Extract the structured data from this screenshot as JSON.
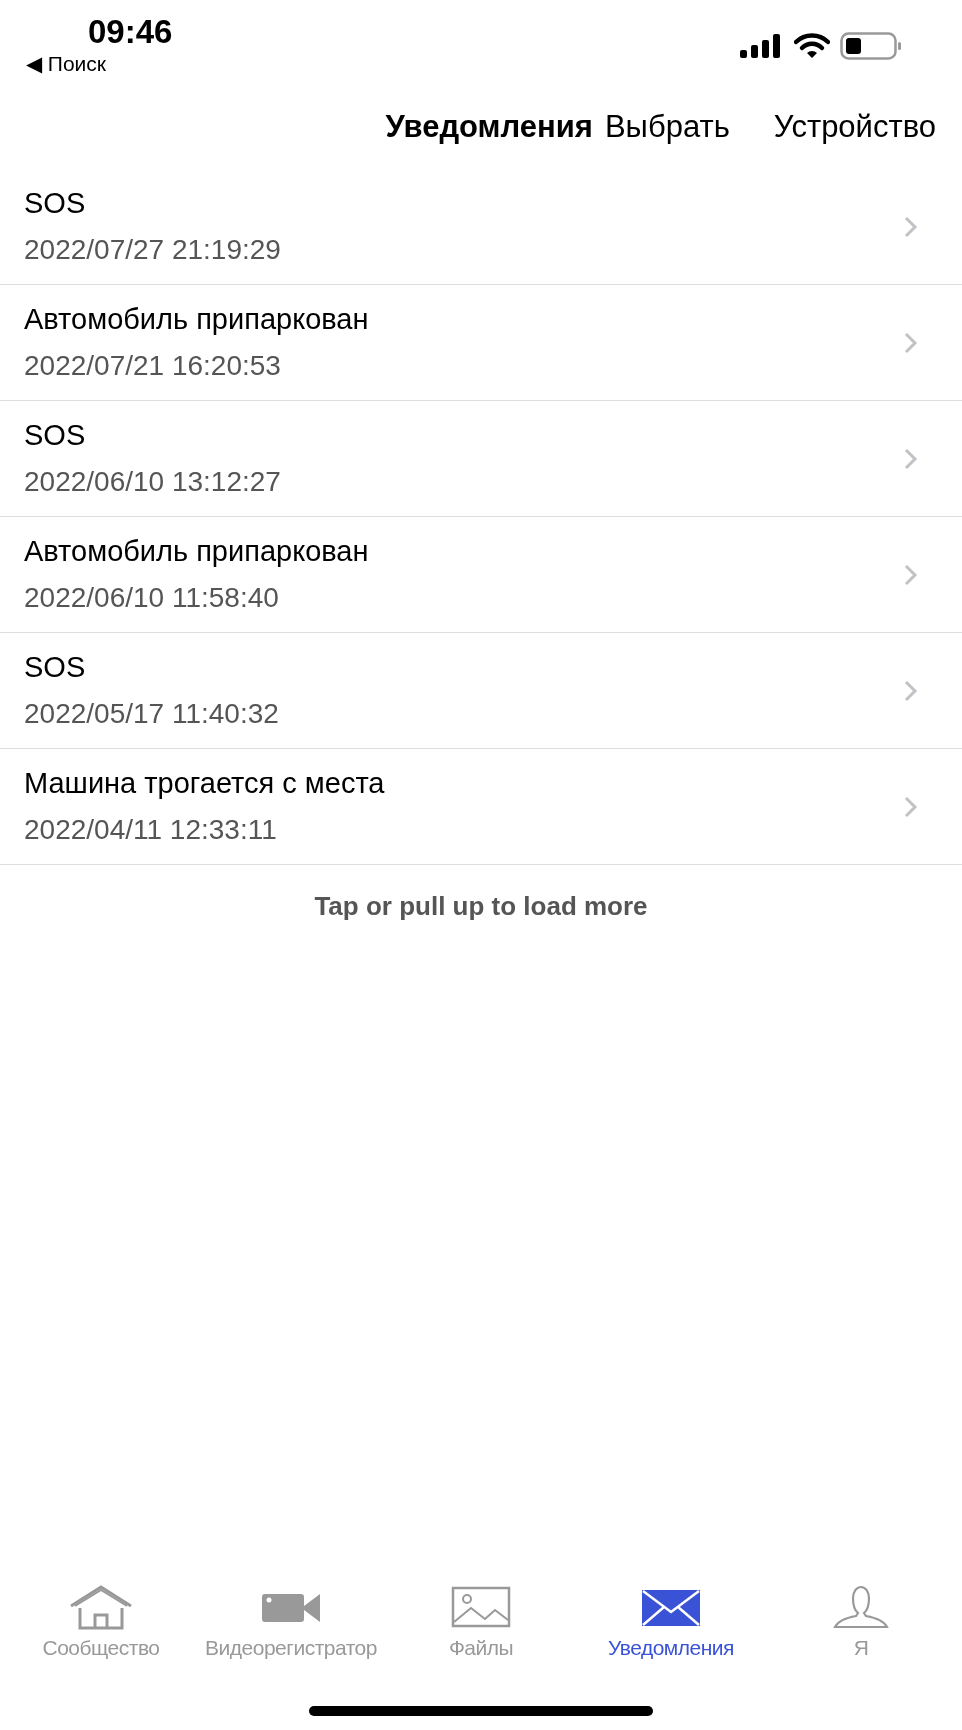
{
  "status_bar": {
    "time": "09:46",
    "back_label": "◀ Поиск"
  },
  "nav_bar": {
    "title": "Уведомления",
    "actions": [
      "Выбрать",
      "Устройство"
    ]
  },
  "notifications": [
    {
      "title": "SOS",
      "time": "2022/07/27 21:19:29"
    },
    {
      "title": "Автомобиль припаркован",
      "time": "2022/07/21 16:20:53"
    },
    {
      "title": "SOS",
      "time": "2022/06/10 13:12:27"
    },
    {
      "title": "Автомобиль припаркован",
      "time": "2022/06/10 11:58:40"
    },
    {
      "title": "SOS",
      "time": "2022/05/17 11:40:32"
    },
    {
      "title": "Машина трогается с места",
      "time": "2022/04/11 12:33:11"
    }
  ],
  "load_more": "Tap or pull up to load more",
  "tab_bar": [
    {
      "kind": "home",
      "label": "Сообщество",
      "selected": false
    },
    {
      "kind": "camera",
      "label": "Видеорегистратор",
      "selected": false
    },
    {
      "kind": "image",
      "label": "Файлы",
      "selected": false
    },
    {
      "kind": "mail",
      "label": "Уведомления",
      "selected": true
    },
    {
      "kind": "person",
      "label": "Я",
      "selected": false
    }
  ]
}
